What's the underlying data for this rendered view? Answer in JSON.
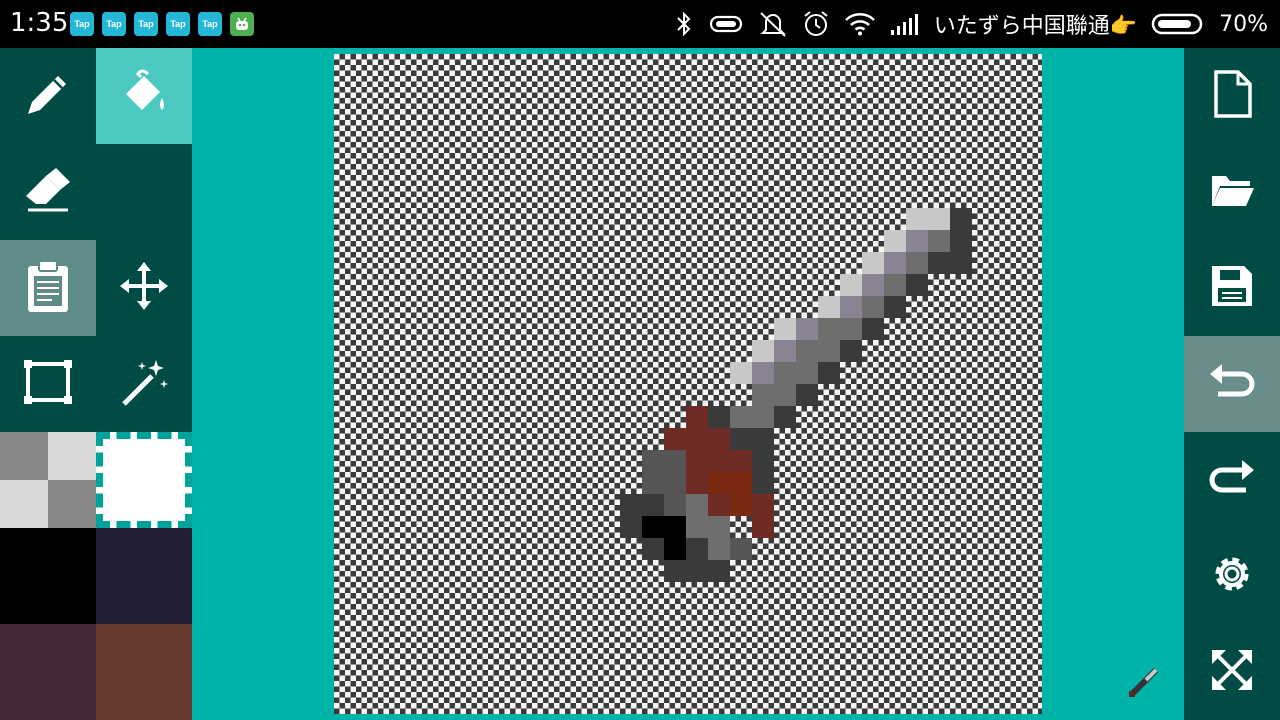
{
  "status_bar": {
    "time": "1:35",
    "notifications": [
      "Tap",
      "Tap",
      "Tap",
      "Tap",
      "Tap"
    ],
    "carrier": "いたずら中国聯通👉",
    "battery": "70%"
  },
  "tools": {
    "left": [
      "pencil",
      "fill-bucket",
      "eraser",
      "clipboard",
      "move",
      "rectangle",
      "magic-wand"
    ],
    "active_tool": "fill-bucket"
  },
  "palette": [
    "#000000",
    "#222034",
    "#45283c",
    "#663931"
  ],
  "right_toolbar": [
    "new-file",
    "open-folder",
    "save",
    "undo",
    "redo",
    "settings",
    "fullscreen"
  ],
  "colors": {
    "panel": "#004b44",
    "accent": "#4cc9c1",
    "background": "#00b3a9"
  }
}
